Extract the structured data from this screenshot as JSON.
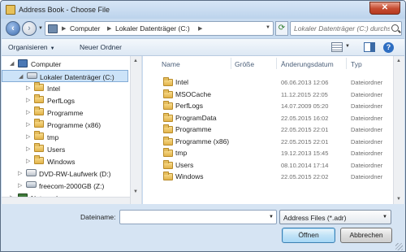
{
  "window": {
    "title": "Address Book - Choose File",
    "close_glyph": "✕"
  },
  "address_bar": {
    "crumbs": [
      "Computer",
      "Lokaler Datenträger (C:)"
    ]
  },
  "search": {
    "placeholder": "Lokaler Datenträger (C:) durchsuchen"
  },
  "toolbar": {
    "organize_label": "Organisieren",
    "new_folder_label": "Neuer Ordner"
  },
  "nav_tree": [
    {
      "label": "Computer",
      "icon": "computer-icon",
      "level": 0,
      "expanded": true
    },
    {
      "label": "Lokaler Datenträger (C:)",
      "icon": "drive-icon",
      "level": 1,
      "expanded": true,
      "selected": true
    },
    {
      "label": "Intel",
      "icon": "folder-icon",
      "level": 2
    },
    {
      "label": "PerfLogs",
      "icon": "folder-icon",
      "level": 2
    },
    {
      "label": "Programme",
      "icon": "folder-icon",
      "level": 2
    },
    {
      "label": "Programme (x86)",
      "icon": "folder-icon",
      "level": 2
    },
    {
      "label": "tmp",
      "icon": "folder-icon",
      "level": 2
    },
    {
      "label": "Users",
      "icon": "folder-icon",
      "level": 2
    },
    {
      "label": "Windows",
      "icon": "folder-icon",
      "level": 2
    },
    {
      "label": "DVD-RW-Laufwerk (D:)",
      "icon": "dvd-icon",
      "level": 1
    },
    {
      "label": "freecom-2000GB (Z:)",
      "icon": "drive-icon",
      "level": 1
    },
    {
      "label": "Netzwerk",
      "icon": "network-icon",
      "level": 0
    }
  ],
  "columns": {
    "name": "Name",
    "size": "Größe",
    "date": "Änderungsdatum",
    "type": "Typ"
  },
  "files": [
    {
      "name": "Intel",
      "date": "06.06.2013 12:06",
      "type": "Dateiordner"
    },
    {
      "name": "MSOCache",
      "date": "11.12.2015 22:05",
      "type": "Dateiordner"
    },
    {
      "name": "PerfLogs",
      "date": "14.07.2009 05:20",
      "type": "Dateiordner"
    },
    {
      "name": "ProgramData",
      "date": "22.05.2015 16:02",
      "type": "Dateiordner"
    },
    {
      "name": "Programme",
      "date": "22.05.2015 22:01",
      "type": "Dateiordner"
    },
    {
      "name": "Programme (x86)",
      "date": "22.05.2015 22:01",
      "type": "Dateiordner"
    },
    {
      "name": "tmp",
      "date": "19.12.2013 15:45",
      "type": "Dateiordner"
    },
    {
      "name": "Users",
      "date": "08.10.2014 17:14",
      "type": "Dateiordner"
    },
    {
      "name": "Windows",
      "date": "22.05.2015 22:02",
      "type": "Dateiordner"
    }
  ],
  "footer": {
    "filename_label": "Dateiname:",
    "filename_value": "",
    "filetype_value": "Address Files (*.adr)",
    "open_label": "Öffnen",
    "cancel_label": "Abbrechen"
  }
}
